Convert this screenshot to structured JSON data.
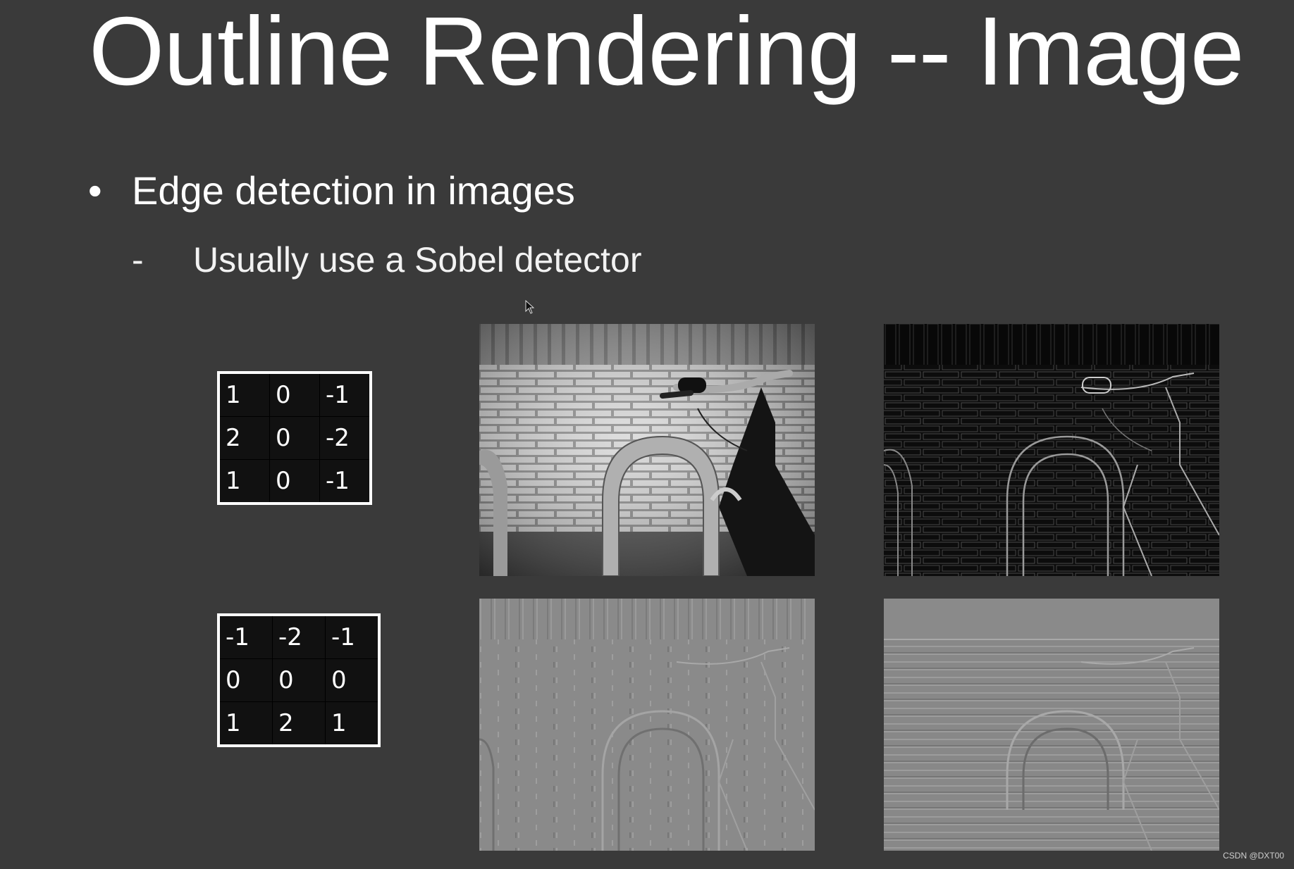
{
  "slide": {
    "title": "Outline Rendering -- Image",
    "bullet": "Edge detection in images",
    "bullet_symbol": "•",
    "sub_bullet": "Usually use a Sobel detector",
    "sub_bullet_symbol": "-"
  },
  "kernels": {
    "x": [
      [
        "1",
        "0",
        "-1"
      ],
      [
        "2",
        "0",
        "-2"
      ],
      [
        "1",
        "0",
        "-1"
      ]
    ],
    "y": [
      [
        "-1",
        "-2",
        "-1"
      ],
      [
        "0",
        "0",
        "0"
      ],
      [
        "1",
        "2",
        "1"
      ]
    ]
  },
  "images": [
    {
      "name": "original-photo",
      "icon": "bike-rack-photo"
    },
    {
      "name": "edge-magnitude",
      "icon": "bike-rack-edges"
    },
    {
      "name": "gradient-x",
      "icon": "bike-rack-gx"
    },
    {
      "name": "gradient-y",
      "icon": "bike-rack-gy"
    }
  ],
  "watermark": "CSDN @DXT00",
  "colors": {
    "background": "#3a3a3a",
    "text": "#ffffff"
  }
}
